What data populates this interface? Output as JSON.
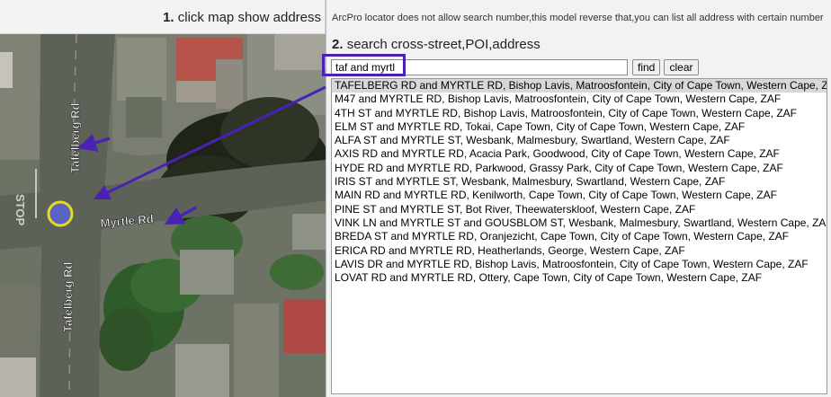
{
  "left_header": {
    "step_number": "1.",
    "step_text": "click map show address"
  },
  "map": {
    "road_labels": [
      "Tafelberg Rd",
      "Tafelberg Rd",
      "Myrtle Rd"
    ],
    "painted_text": "STOP"
  },
  "right_panel": {
    "note": "ArcPro locator does not allow search number,this model reverse that,you can list all address with certain number",
    "step_number": "2.",
    "step_text": "search cross-street,POI,address",
    "search_value": "taf and myrtl",
    "find_label": "find",
    "clear_label": "clear",
    "results": [
      "TAFELBERG RD and MYRTLE RD, Bishop Lavis, Matroosfontein, City of Cape Town, Western Cape, ZAF",
      "M47 and MYRTLE RD, Bishop Lavis, Matroosfontein, City of Cape Town, Western Cape, ZAF",
      "4TH ST and MYRTLE RD, Bishop Lavis, Matroosfontein, City of Cape Town, Western Cape, ZAF",
      "ELM ST and MYRTLE RD, Tokai, Cape Town, City of Cape Town, Western Cape, ZAF",
      "ALFA ST and MYRTLE ST, Wesbank, Malmesbury, Swartland, Western Cape, ZAF",
      "AXIS RD and MYRTLE RD, Acacia Park, Goodwood, City of Cape Town, Western Cape, ZAF",
      "HYDE RD and MYRTLE RD, Parkwood, Grassy Park, City of Cape Town, Western Cape, ZAF",
      "IRIS ST and MYRTLE ST, Wesbank, Malmesbury, Swartland, Western Cape, ZAF",
      "MAIN RD and MYRTLE RD, Kenilworth, Cape Town, City of Cape Town, Western Cape, ZAF",
      "PINE ST and MYRTLE ST, Bot River, Theewaterskloof, Western Cape, ZAF",
      "VINK LN and MYRTLE ST and GOUSBLOM ST, Wesbank, Malmesbury, Swartland, Western Cape, ZAF",
      "BREDA ST and MYRTLE RD, Oranjezicht, Cape Town, City of Cape Town, Western Cape, ZAF",
      "ERICA RD and MYRTLE RD, Heatherlands, George, Western Cape, ZAF",
      "LAVIS DR and MYRTLE RD, Bishop Lavis, Matroosfontein, City of Cape Town, Western Cape, ZAF",
      "LOVAT RD and MYRTLE RD, Ottery, Cape Town, City of Cape Town, Western Cape, ZAF"
    ],
    "selected_index": 0
  },
  "colors": {
    "annotation_purple": "#4a22b3",
    "marker_fill": "#5a63c4",
    "marker_ring": "#e1dc1e"
  }
}
